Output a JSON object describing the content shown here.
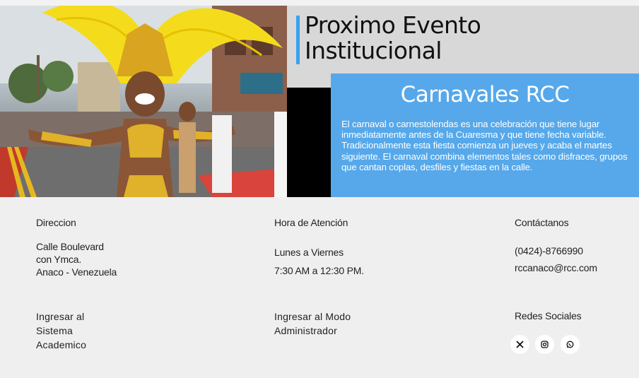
{
  "hero": {
    "title_line1": "Proximo Evento",
    "title_line2": "Institucional",
    "event_name": "Carnavales RCC",
    "event_description": "El carnaval o carnestolendas es una celebración que tiene lugar inmediatamente antes de la Cuaresma y que tiene fecha variable. Tradicionalmente esta fiesta comienza un jueves y acaba el martes siguiente. El carnaval combina elementos tales como disfraces, grupos que cantan coplas, desfiles y fiestas en la calle."
  },
  "footer": {
    "address": {
      "label": "Direccion",
      "line1": "Calle Boulevard",
      "line2": "con Ymca.",
      "line3": "Anaco - Venezuela"
    },
    "hours": {
      "label": "Hora de Atención",
      "days": "Lunes a Viernes",
      "time": "7:30 AM a 12:30 PM."
    },
    "contact": {
      "label": "Contáctanos",
      "phone": "(0424)-8766990",
      "email": "rccanaco@rcc.com"
    },
    "links": {
      "academic_line1": "Ingresar al",
      "academic_line2": "Sistema",
      "academic_line3": "Academico",
      "admin_line1": "Ingresar al Modo",
      "admin_line2": "Administrador"
    },
    "social": {
      "label": "Redes Sociales",
      "icons": [
        "x-icon",
        "instagram-icon",
        "whatsapp-icon"
      ]
    }
  },
  "colors": {
    "accent": "#3aa0f0",
    "card": "#56a8ea",
    "header_bg": "#d8d8d8",
    "page_bg": "#efefef"
  }
}
